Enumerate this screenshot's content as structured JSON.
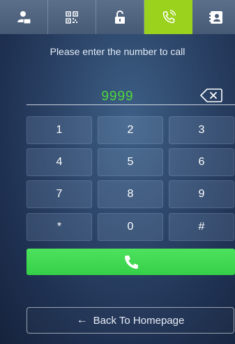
{
  "tabs": [
    {
      "icon": "user-card-icon",
      "active": false
    },
    {
      "icon": "qr-code-icon",
      "active": false
    },
    {
      "icon": "unlock-icon",
      "active": false
    },
    {
      "icon": "phone-call-icon",
      "active": true
    },
    {
      "icon": "contact-card-icon",
      "active": false
    }
  ],
  "prompt": "Please enter the number to call",
  "number_input": {
    "value": "9999"
  },
  "backspace_icon": "backspace-icon",
  "keypad": [
    {
      "label": "1"
    },
    {
      "label": "2"
    },
    {
      "label": "3"
    },
    {
      "label": "4"
    },
    {
      "label": "5"
    },
    {
      "label": "6"
    },
    {
      "label": "7"
    },
    {
      "label": "8"
    },
    {
      "label": "9"
    },
    {
      "label": "*"
    },
    {
      "label": "0"
    },
    {
      "label": "#"
    }
  ],
  "call_button": {
    "icon": "phone-icon"
  },
  "back_button": {
    "arrow": "←",
    "label": "Back To Homepage"
  },
  "colors": {
    "accent_green": "#9bd21e",
    "call_green": "#40d852",
    "number_green": "#4ed93a",
    "tab_bg": "#4a5d78"
  }
}
